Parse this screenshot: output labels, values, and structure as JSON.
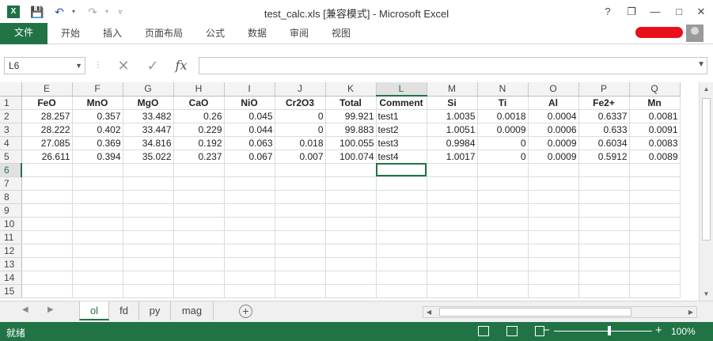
{
  "window": {
    "title": "test_calc.xls  [兼容模式] - Microsoft Excel",
    "help": "?",
    "minimize": "—",
    "restore": "❐",
    "close": "✕"
  },
  "ribbon": {
    "file_label": "文件",
    "tabs": [
      "开始",
      "插入",
      "页面布局",
      "公式",
      "数据",
      "审阅",
      "视图"
    ]
  },
  "formula_bar": {
    "name_box": "L6",
    "cancel": "✕",
    "enter": "✓",
    "fx": "fx",
    "content": ""
  },
  "grid": {
    "columns": [
      "E",
      "F",
      "G",
      "H",
      "I",
      "J",
      "K",
      "L",
      "M",
      "N",
      "O",
      "P",
      "Q"
    ],
    "selected_column": "L",
    "rows": [
      {
        "n": "1",
        "cells": [
          "FeO",
          "MnO",
          "MgO",
          "CaO",
          "NiO",
          "Cr2O3",
          "Total",
          "Comment",
          "Si",
          "Ti",
          "Al",
          "Fe2+",
          "Mn"
        ]
      },
      {
        "n": "2",
        "cells": [
          "28.257",
          "0.357",
          "33.482",
          "0.26",
          "0.045",
          "0",
          "99.921",
          "test1",
          "1.0035",
          "0.0018",
          "0.0004",
          "0.6337",
          "0.0081"
        ]
      },
      {
        "n": "3",
        "cells": [
          "28.222",
          "0.402",
          "33.447",
          "0.229",
          "0.044",
          "0",
          "99.883",
          "test2",
          "1.0051",
          "0.0009",
          "0.0006",
          "0.633",
          "0.0091"
        ]
      },
      {
        "n": "4",
        "cells": [
          "27.085",
          "0.369",
          "34.816",
          "0.192",
          "0.063",
          "0.018",
          "100.055",
          "test3",
          "0.9984",
          "0",
          "0.0009",
          "0.6034",
          "0.0083"
        ]
      },
      {
        "n": "5",
        "cells": [
          "26.611",
          "0.394",
          "35.022",
          "0.237",
          "0.067",
          "0.007",
          "100.074",
          "test4",
          "1.0017",
          "0",
          "0.0009",
          "0.5912",
          "0.0089"
        ]
      },
      {
        "n": "6",
        "cells": [
          "",
          "",
          "",
          "",
          "",
          "",
          "",
          "",
          "",
          "",
          "",
          "",
          ""
        ]
      },
      {
        "n": "7",
        "cells": [
          "",
          "",
          "",
          "",
          "",
          "",
          "",
          "",
          "",
          "",
          "",
          "",
          ""
        ]
      },
      {
        "n": "8",
        "cells": [
          "",
          "",
          "",
          "",
          "",
          "",
          "",
          "",
          "",
          "",
          "",
          "",
          ""
        ]
      },
      {
        "n": "9",
        "cells": [
          "",
          "",
          "",
          "",
          "",
          "",
          "",
          "",
          "",
          "",
          "",
          "",
          ""
        ]
      },
      {
        "n": "10",
        "cells": [
          "",
          "",
          "",
          "",
          "",
          "",
          "",
          "",
          "",
          "",
          "",
          "",
          ""
        ]
      },
      {
        "n": "11",
        "cells": [
          "",
          "",
          "",
          "",
          "",
          "",
          "",
          "",
          "",
          "",
          "",
          "",
          ""
        ]
      },
      {
        "n": "12",
        "cells": [
          "",
          "",
          "",
          "",
          "",
          "",
          "",
          "",
          "",
          "",
          "",
          "",
          ""
        ]
      },
      {
        "n": "13",
        "cells": [
          "",
          "",
          "",
          "",
          "",
          "",
          "",
          "",
          "",
          "",
          "",
          "",
          ""
        ]
      },
      {
        "n": "14",
        "cells": [
          "",
          "",
          "",
          "",
          "",
          "",
          "",
          "",
          "",
          "",
          "",
          "",
          ""
        ]
      },
      {
        "n": "15",
        "cells": [
          "",
          "",
          "",
          "",
          "",
          "",
          "",
          "",
          "",
          "",
          "",
          "",
          ""
        ]
      }
    ],
    "active_row": "6"
  },
  "sheets": {
    "tabs": [
      "ol",
      "fd",
      "py",
      "mag"
    ],
    "active": "ol",
    "add": "+"
  },
  "status": {
    "ready": "就绪",
    "zoom": "100%",
    "zoom_out": "−",
    "zoom_in": "+"
  },
  "colors": {
    "accent": "#217346",
    "grid_line": "#dadcdd",
    "header_bg": "#f3f3f3"
  }
}
